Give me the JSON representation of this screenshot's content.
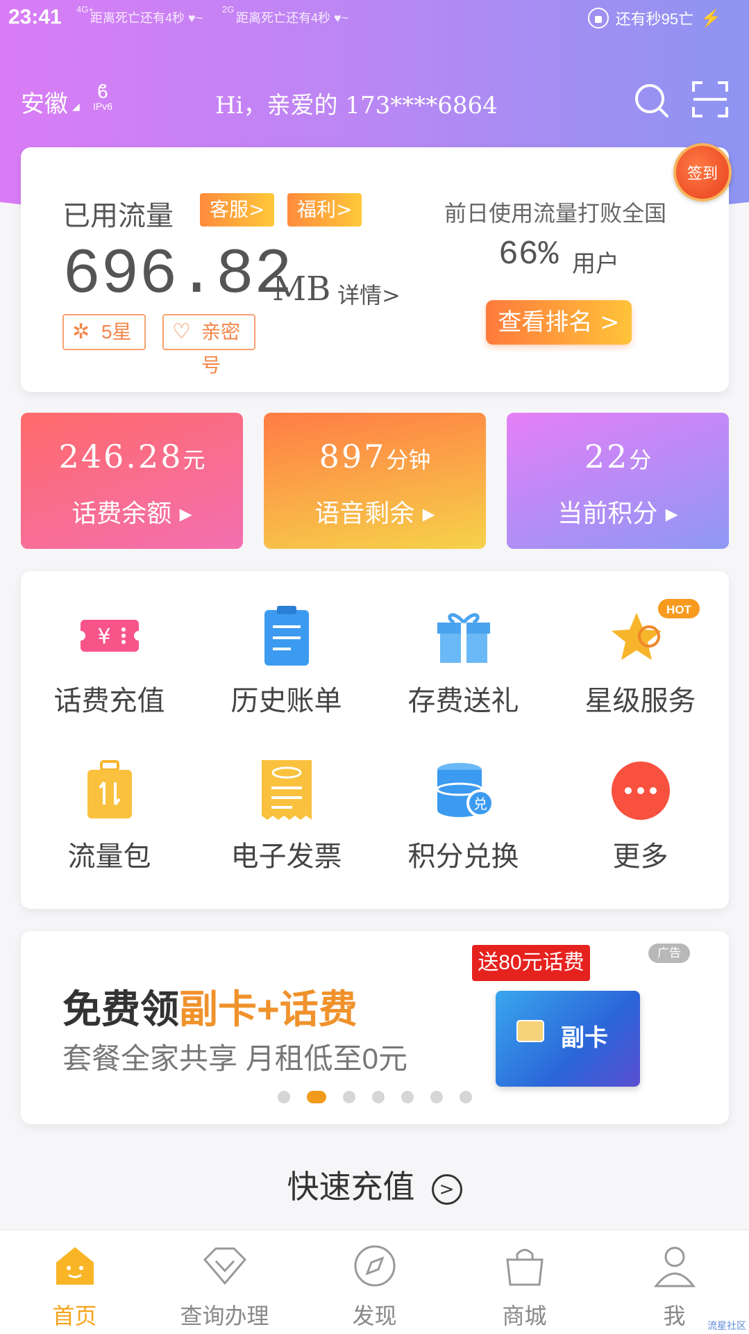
{
  "status_bar": {
    "time": "23:41",
    "notices": [
      {
        "net": "4G+",
        "text": "距离死亡还有4秒 ♥~"
      },
      {
        "net": "2G",
        "text": "距离死亡还有4秒 ♥~"
      }
    ],
    "right_text": "还有秒95亡"
  },
  "header": {
    "region": "安徽",
    "ipv6_label": "IPv6",
    "greeting": "Hi，亲爱的 173****6864"
  },
  "data_card": {
    "signin_label": "签到",
    "used_label": "已用流量",
    "service_pill": "客服>",
    "welfare_pill": "福利>",
    "usage_value": "696.82",
    "usage_unit": "MB",
    "detail_link": "详情>",
    "star_tag": "5星",
    "family_tag": "亲密号",
    "rank_text": "前日使用流量打败全国",
    "rank_value": "66%",
    "rank_suffix": "用户",
    "rank_button": "查看排名 >"
  },
  "stats": [
    {
      "value": "246.28",
      "unit": "元",
      "label": "话费余额 ▸"
    },
    {
      "value": "897",
      "unit": "分钟",
      "label": "语音剩余 ▸"
    },
    {
      "value": "22",
      "unit": "分",
      "label": "当前积分 ▸"
    }
  ],
  "services": [
    {
      "label": "话费充值",
      "icon": "ticket-icon"
    },
    {
      "label": "历史账单",
      "icon": "clipboard-icon"
    },
    {
      "label": "存费送礼",
      "icon": "gift-icon"
    },
    {
      "label": "星级服务",
      "icon": "star-icon",
      "badge": "HOT"
    },
    {
      "label": "流量包",
      "icon": "luggage-icon"
    },
    {
      "label": "电子发票",
      "icon": "receipt-icon"
    },
    {
      "label": "积分兑换",
      "icon": "database-icon"
    },
    {
      "label": "更多",
      "icon": "more-icon"
    }
  ],
  "banner": {
    "ad_tag": "广告",
    "title_plain": "免费领",
    "title_highlight": "副卡+话费",
    "subtitle": "套餐全家共享 月租低至0元",
    "promo_tag": "送80元话费",
    "card_label": "副卡",
    "page_count": 7,
    "active_page": 2
  },
  "quick_recharge": {
    "label": "快速充值",
    "arrow": ">"
  },
  "tabs": [
    {
      "label": "首页",
      "icon": "home-icon",
      "active": true
    },
    {
      "label": "查询办理",
      "icon": "diamond-icon",
      "active": false
    },
    {
      "label": "发现",
      "icon": "compass-icon",
      "active": false
    },
    {
      "label": "商城",
      "icon": "shopping-bag-icon",
      "active": false
    },
    {
      "label": "我",
      "icon": "user-icon",
      "active": false
    }
  ],
  "watermark": "流星社区",
  "colors": {
    "header_gradient": [
      "#d97cf5",
      "#8d95f2"
    ],
    "accent_orange": "#f5a41c",
    "promo_red": "#e6221f"
  }
}
